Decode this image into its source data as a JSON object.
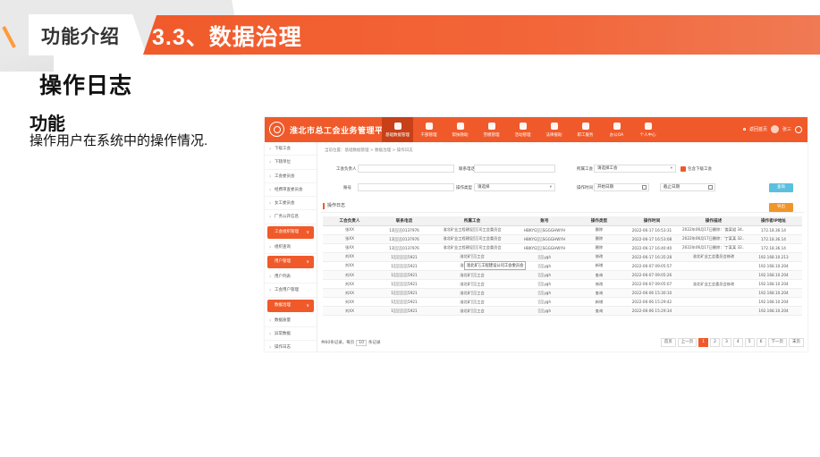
{
  "slide": {
    "section_label": "功能介绍",
    "section_title": "3.3、数据治理",
    "page_title": "操作日志",
    "feature_label": "功能",
    "feature_desc": "操作用户在系统中的操作情况."
  },
  "app": {
    "name": "淮北市总工会业务管理平台",
    "nav": [
      {
        "label": "基础数据管理",
        "icon": "database-icon",
        "active": true
      },
      {
        "label": "干部管理",
        "icon": "user-icon"
      },
      {
        "label": "帮扶救助",
        "icon": "heart-icon"
      },
      {
        "label": "劳模管理",
        "icon": "medal-icon"
      },
      {
        "label": "活动管理",
        "icon": "calendar-icon"
      },
      {
        "label": "法律援助",
        "icon": "scale-icon"
      },
      {
        "label": "职工服务",
        "icon": "service-icon"
      },
      {
        "label": "办公OA",
        "icon": "briefcase-icon"
      },
      {
        "label": "个人中心",
        "icon": "person-icon"
      }
    ],
    "top_right": {
      "home": "返回首页",
      "user": "张三"
    },
    "sidebar": {
      "items_top": [
        "下级工会",
        "下辖单位",
        "工会委员会",
        "经费审查委员会",
        "女工委员会",
        "厂务公开信息"
      ],
      "group1": "工会组织管理",
      "group1_items": [
        "组织查询"
      ],
      "group2": "用户管理",
      "group2_items": [
        "用户列表",
        "工会用户管理"
      ],
      "group3": "数据治理",
      "group3_items": [
        "数据质量",
        "异常数据",
        "操作日志"
      ]
    },
    "breadcrumb": "当前位置：基础数据管理 > 数据治理 > 操作日志",
    "filters": {
      "leader_label": "工会负责人",
      "phone_label": "联系电话",
      "union_label": "所属工会",
      "union_placeholder": "请选择工会",
      "include_sub_label": "包含下级工会",
      "account_label": "账号",
      "optype_label": "操作类型",
      "optype_value": "请选择",
      "optime_label": "操作时间",
      "start_placeholder": "开始日期",
      "end_placeholder": "截止日期",
      "query_button": "查询",
      "export_button": "导出"
    },
    "section_title": "操作日志",
    "columns": [
      "工会负责人",
      "联系电话",
      "所属工会",
      "账号",
      "操作类型",
      "操作时间",
      "操作描述",
      "操作者IP地址"
    ],
    "rows": [
      [
        "张XX",
        "13░░░0137976",
        "淮北矿业工程建设░░司工会委员会",
        "HBKYG░░SGGGHWYH",
        "删除",
        "2022-06-17 16:53:31",
        "2022年06月17日删除：'姜某姐 34...",
        "172.18.36.14"
      ],
      [
        "张XX",
        "13░░░0137976",
        "淮北矿业工程建设░░司工会委员会",
        "HBKYG░░SGGGHWYH",
        "删除",
        "2022-06-17 16:53:08",
        "2022年06月17日删除：'丁某某 32...",
        "172.18.36.14"
      ],
      [
        "张XX",
        "13░░░0137976",
        "淮北矿业工程建设░░司工会委员会",
        "HBKYG░░SGGGHWYH",
        "删除",
        "2022-06-17 16:40:40",
        "2022年06月17日删除：'丁某某 32...",
        "172.18.36.14"
      ],
      [
        "刘XX",
        "1░░░░░5921",
        "淮北矿░░工会",
        "░░ygh",
        "修改",
        "2022-06-17 16:35:28",
        "淮北矿业工会委员会修改",
        "192.168.10.213"
      ],
      [
        "刘XX",
        "1░░░░░5921",
        "淮北矿░░工会",
        "░░ygh",
        "新增",
        "2022-06-07 09:05:57",
        "",
        "192.168.10.204"
      ],
      [
        "刘XX",
        "1░░░░░5921",
        "淮北矿░░工会",
        "░░ygh",
        "查询",
        "2022-06-07 09:05:26",
        "",
        "192.168.10.204"
      ],
      [
        "刘XX",
        "1░░░░░5921",
        "淮北矿░░工会",
        "░░ygh",
        "修改",
        "2022-06-07 09:05:07",
        "淮北矿业工会委员会修改",
        "192.168.10.204"
      ],
      [
        "刘XX",
        "1░░░░░5921",
        "淮北矿░░工会",
        "░░ygh",
        "查询",
        "2022-06-06 15:30:10",
        "",
        "192.168.10.204"
      ],
      [
        "刘XX",
        "1░░░░░5921",
        "淮北矿░░工会",
        "░░ygh",
        "新增",
        "2022-06-06 15:29:42",
        "",
        "192.168.10.204"
      ],
      [
        "刘XX",
        "1░░░░░5921",
        "淮北矿░░工会",
        "░░ygh",
        "查询",
        "2022-06-06 15:29:34",
        "",
        "192.168.10.204"
      ]
    ],
    "tooltip": "淮北矿░工程建设公司工会委员会",
    "pagination": {
      "total_text": "共60条记录，每页",
      "page_size": "10",
      "per_page_suffix": "条记录",
      "first": "首页",
      "prev": "上一页",
      "pages": [
        "1",
        "2",
        "3",
        "4",
        "5",
        "6"
      ],
      "next": "下一页",
      "last": "末页",
      "current": "1"
    }
  },
  "colors": {
    "brand": "#f05a2a",
    "query": "#5bc0de",
    "export": "#f0952a"
  }
}
